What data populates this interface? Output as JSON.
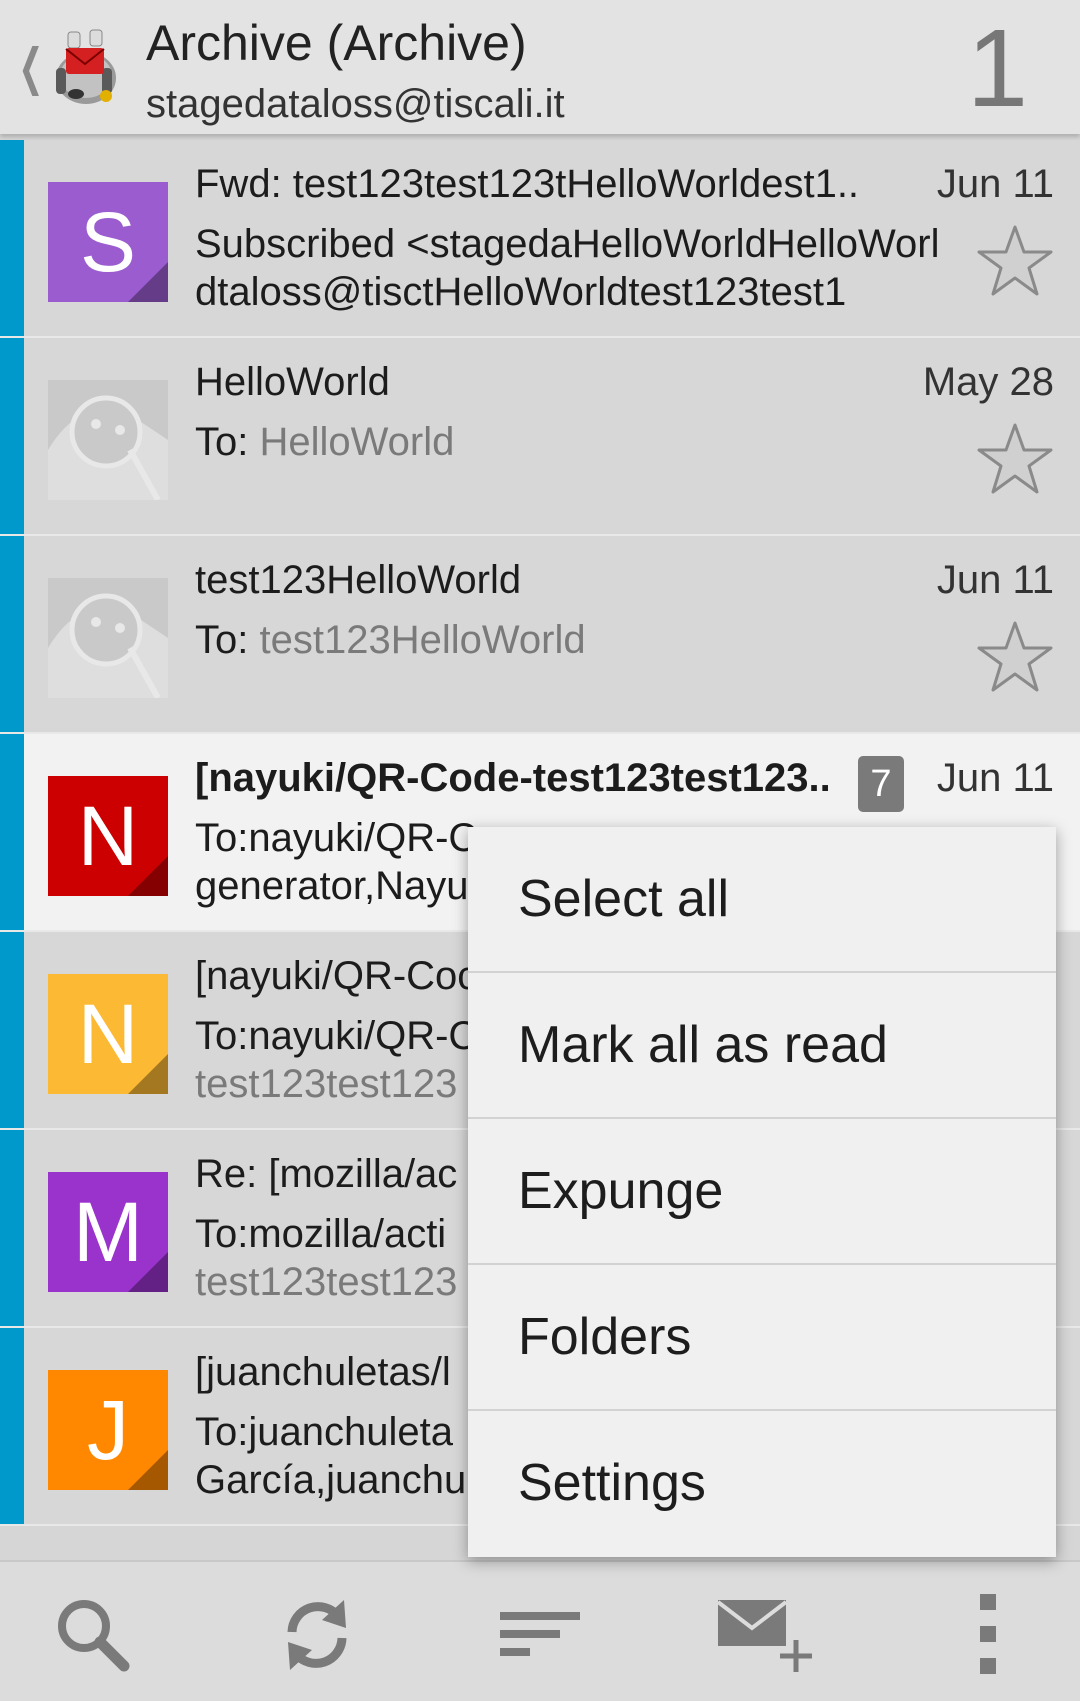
{
  "header": {
    "title": "Archive (Archive)",
    "account": "stagedataloss@tiscali.it",
    "unread_count": "1"
  },
  "messages": [
    {
      "avatar_letter": "S",
      "avatar_color": "#9a5ccf",
      "subject": "Fwd: test123test123tHelloWorldest1..",
      "date": "Jun 11",
      "preview_prefix": "",
      "preview": "Subscribed <stagedaHelloWorldHelloWorldtaloss@tisctHelloWorldtest123test1",
      "unread": false
    },
    {
      "avatar_letter": "",
      "avatar_color": "#c7c7c7",
      "subject": "HelloWorld",
      "date": "May 28",
      "preview_prefix": "To: ",
      "preview": "HelloWorld",
      "unread": false
    },
    {
      "avatar_letter": "",
      "avatar_color": "#c7c7c7",
      "subject": "test123HelloWorld",
      "date": "Jun 11",
      "preview_prefix": "To: ",
      "preview": "test123HelloWorld",
      "unread": false
    },
    {
      "avatar_letter": "N",
      "avatar_color": "#cc0000",
      "subject": "[nayuki/QR-Code-test123test123..",
      "date": "Jun 11",
      "thread_count": "7",
      "preview_prefix": "",
      "preview": "To:nayuki/QR-C",
      "preview_line2": "generator,Nayu",
      "unread": true
    },
    {
      "avatar_letter": "N",
      "avatar_color": "#fbb934",
      "subject": "[nayuki/QR-Coc",
      "date": "",
      "preview_prefix": "",
      "preview": "To:nayuki/QR-C",
      "preview_line2": "test123test123",
      "unread": false
    },
    {
      "avatar_letter": "M",
      "avatar_color": "#9933cc",
      "subject": "Re: [mozilla/ac",
      "date": "",
      "preview_prefix": "",
      "preview": "To:mozilla/acti",
      "preview_line2": "test123test123",
      "unread": false
    },
    {
      "avatar_letter": "J",
      "avatar_color": "#ff8800",
      "subject": "[juanchuletas/l",
      "date": "",
      "preview_prefix": "",
      "preview": "To:juanchuleta",
      "preview_line2": "García,juanchu",
      "unread": false
    }
  ],
  "menu": {
    "items": [
      "Select all",
      "Mark all as read",
      "Expunge",
      "Folders",
      "Settings"
    ]
  },
  "bottom_bar": {
    "icons": [
      "search-icon",
      "refresh-icon",
      "sort-icon",
      "compose-icon",
      "overflow-menu-icon"
    ]
  },
  "colors": {
    "accent_stripe": "#0099cc",
    "header_bg": "#e3e3e3",
    "list_bg": "#d7d7d7",
    "unread_bg": "#f2f2f2",
    "menu_bg": "#f0f0f0"
  }
}
